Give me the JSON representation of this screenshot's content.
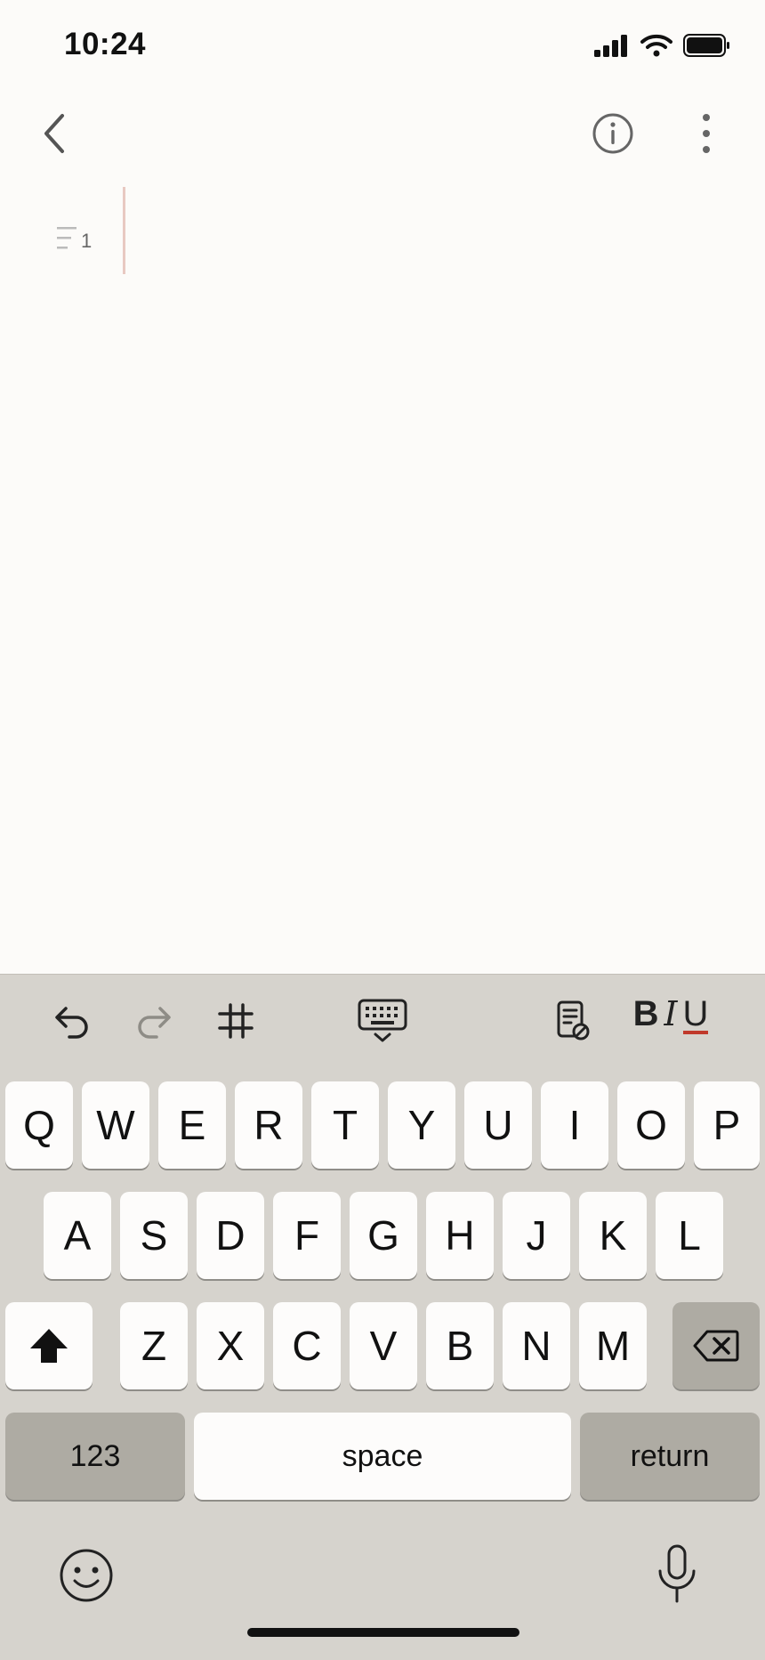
{
  "status_bar": {
    "time": "10:24"
  },
  "keyboard": {
    "row1": [
      "Q",
      "W",
      "E",
      "R",
      "T",
      "Y",
      "U",
      "I",
      "O",
      "P"
    ],
    "row2": [
      "A",
      "S",
      "D",
      "F",
      "G",
      "H",
      "J",
      "K",
      "L"
    ],
    "row3": [
      "Z",
      "X",
      "C",
      "V",
      "B",
      "N",
      "M"
    ],
    "numbers_label": "123",
    "space_label": "space",
    "return_label": "return"
  },
  "editor": {
    "line_number": "1"
  },
  "format_toolbar": {
    "bold": "B",
    "italic": "I",
    "underline": "U"
  },
  "colors": {
    "underline_accent": "#c0392b",
    "caret": "#e8c9c2"
  }
}
